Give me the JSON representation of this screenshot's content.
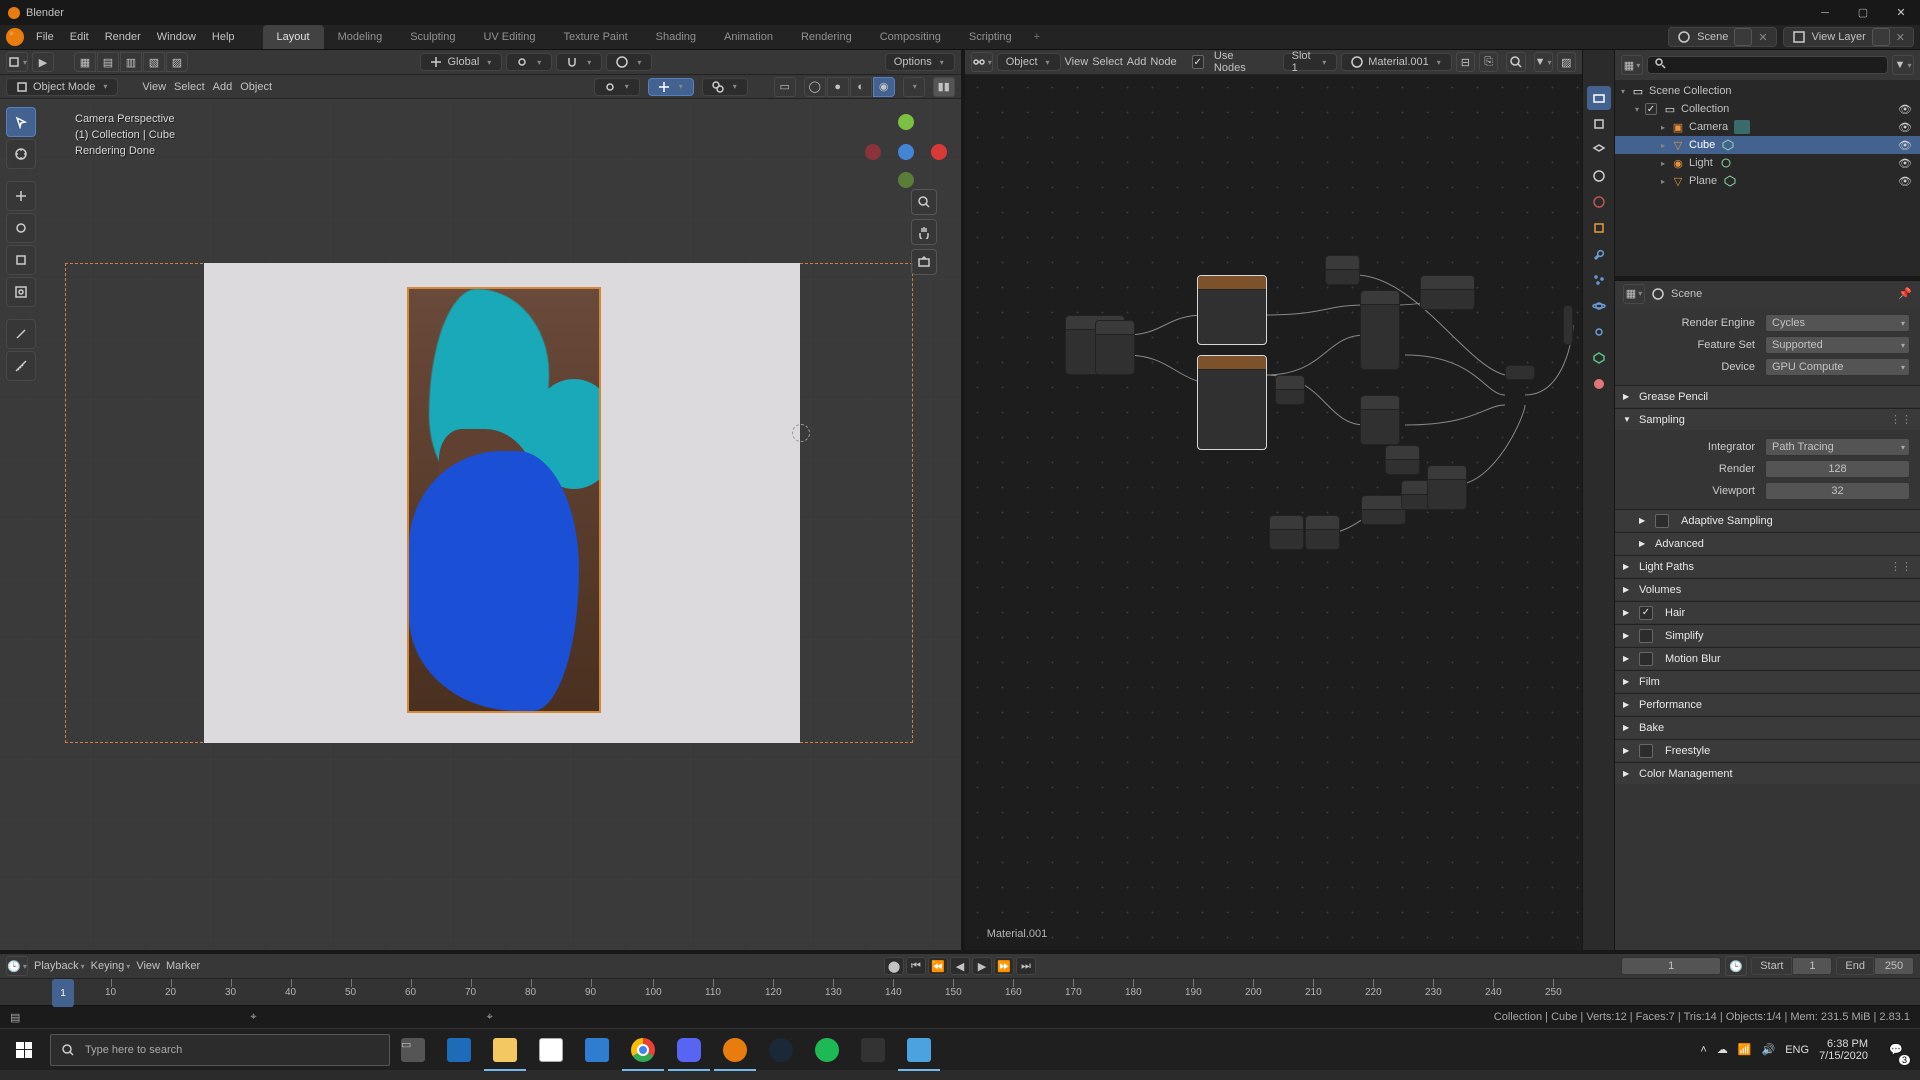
{
  "window": {
    "title": "Blender"
  },
  "menu": {
    "items": [
      "File",
      "Edit",
      "Render",
      "Window",
      "Help"
    ]
  },
  "workspaces": {
    "tabs": [
      "Layout",
      "Modeling",
      "Sculpting",
      "UV Editing",
      "Texture Paint",
      "Shading",
      "Animation",
      "Rendering",
      "Compositing",
      "Scripting"
    ],
    "active": 0
  },
  "top_right": {
    "scene_label": "Scene",
    "viewlayer_label": "View Layer"
  },
  "viewport_header": {
    "mode": "Object Mode",
    "menus": [
      "View",
      "Select",
      "Add",
      "Object"
    ],
    "orientation": "Global",
    "options": "Options"
  },
  "overlay": {
    "l1": "Camera Perspective",
    "l2": "(1) Collection | Cube",
    "l3": "Rendering Done"
  },
  "node_header": {
    "mode": "Object",
    "menus": [
      "View",
      "Select",
      "Add",
      "Node"
    ],
    "use_nodes": "Use Nodes",
    "slot": "Slot 1",
    "material": "Material.001"
  },
  "material_overlay": "Material.001",
  "outliner": {
    "root": "Scene Collection",
    "collection": "Collection",
    "items": [
      {
        "name": "Camera",
        "kind": "camera"
      },
      {
        "name": "Cube",
        "kind": "mesh",
        "selected": true
      },
      {
        "name": "Light",
        "kind": "light"
      },
      {
        "name": "Plane",
        "kind": "mesh"
      }
    ]
  },
  "props": {
    "context": "Scene",
    "render_engine_l": "Render Engine",
    "render_engine_v": "Cycles",
    "feature_set_l": "Feature Set",
    "feature_set_v": "Supported",
    "device_l": "Device",
    "device_v": "GPU Compute",
    "sections": {
      "grease": "Grease Pencil",
      "sampling": "Sampling",
      "integrator_l": "Integrator",
      "integrator_v": "Path Tracing",
      "render_l": "Render",
      "render_v": "128",
      "viewport_l": "Viewport",
      "viewport_v": "32",
      "adaptive": "Adaptive Sampling",
      "advanced": "Advanced",
      "light_paths": "Light Paths",
      "volumes": "Volumes",
      "hair": "Hair",
      "simplify": "Simplify",
      "motion_blur": "Motion Blur",
      "film": "Film",
      "performance": "Performance",
      "bake": "Bake",
      "freestyle": "Freestyle",
      "color_mgmt": "Color Management"
    }
  },
  "timeline": {
    "menus": {
      "playback": "Playback",
      "keying": "Keying",
      "view": "View",
      "marker": "Marker"
    },
    "current": "1",
    "start_l": "Start",
    "start_v": "1",
    "end_l": "End",
    "end_v": "250",
    "ticks": [
      "10",
      "20",
      "30",
      "40",
      "50",
      "60",
      "70",
      "80",
      "90",
      "100",
      "110",
      "120",
      "130",
      "140",
      "150",
      "160",
      "170",
      "180",
      "190",
      "200",
      "210",
      "220",
      "230",
      "240",
      "250"
    ]
  },
  "statusbar": {
    "right": "Collection | Cube | Verts:12 | Faces:7 | Tris:14 | Objects:1/4 | Mem: 231.5 MiB | 2.83.1"
  },
  "taskbar": {
    "search_placeholder": "Type here to search",
    "lang": "ENG",
    "time": "6:38 PM",
    "date": "7/15/2020"
  }
}
